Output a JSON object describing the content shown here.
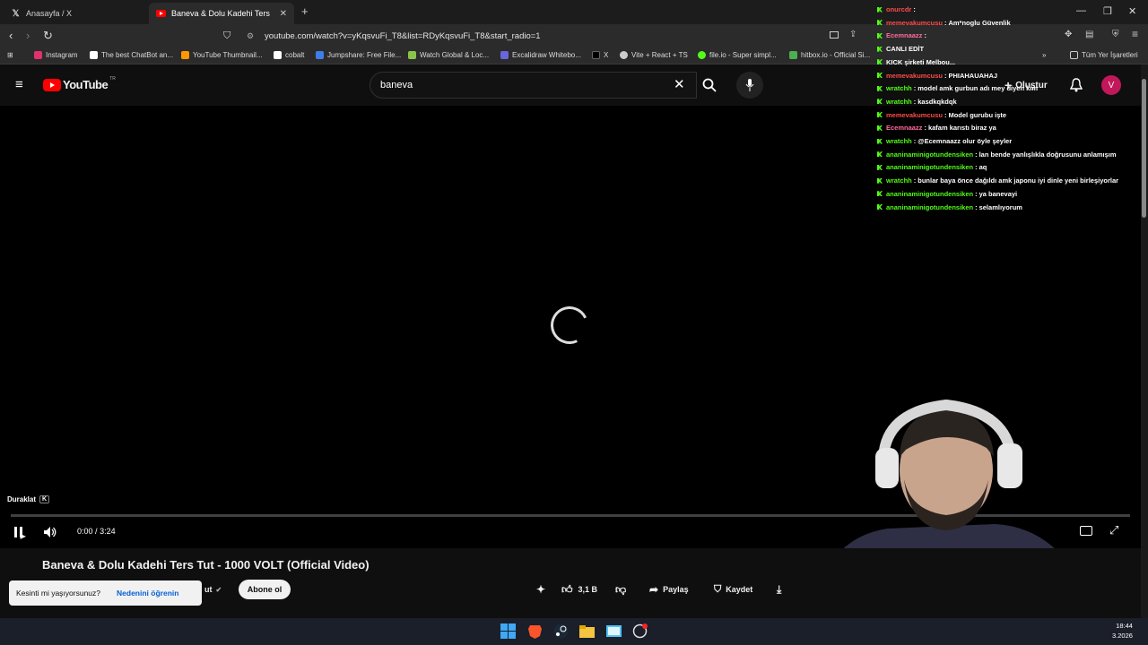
{
  "browser": {
    "tabs": [
      {
        "label": "Anasayfa / X",
        "active": false
      },
      {
        "label": "Baneva & Dolu Kadehi Ters Tut -",
        "active": true
      }
    ],
    "new_tab": "+",
    "url": "youtube.com/watch?v=yKqsvuFi_T8&list=RDyKqsvuFi_T8&start_radio=1",
    "bookmarks": [
      {
        "label": "Instagram",
        "color": "#e1306c"
      },
      {
        "label": "The best ChatBot an...",
        "color": "#ffffff"
      },
      {
        "label": "YouTube Thumbnail...",
        "color": "#ff9800"
      },
      {
        "label": "cobalt",
        "color": "#ffffff"
      },
      {
        "label": "Jumpshare: Free File...",
        "color": "#3f7de8"
      },
      {
        "label": "Watch Global & Loc...",
        "color": "#8bc34a"
      },
      {
        "label": "Excalidraw Whitebo...",
        "color": "#6965db"
      },
      {
        "label": "X",
        "color": "#000000"
      },
      {
        "label": "Vite + React + TS",
        "color": "#cccccc"
      },
      {
        "label": "file.io - Super simpl...",
        "color": "#53fc18"
      },
      {
        "label": "hitbox.io - Official Si...",
        "color": "#4caf50"
      }
    ],
    "all_bookmarks": "Tüm Yer İşaretleri",
    "overflow": "»"
  },
  "youtube": {
    "logo": "YouTube",
    "logo_region": "TR",
    "search_value": "baneva",
    "create_label": "Oluştur",
    "avatar_letter": "V",
    "accent": "#ff0000"
  },
  "player": {
    "tooltip": "Duraklat",
    "tooltip_key": "K",
    "time_current": "0:00",
    "time_separator": "/",
    "time_total": "3:24",
    "progress": 0.0
  },
  "video": {
    "title": "Baneva & Dolu Kadehi Ters Tut - 1000 VOLT (Official Video)",
    "channel_fragment": "ut",
    "subscribe_label": "Abone ol",
    "likes": "3,1 B",
    "share_label": "Paylaş",
    "save_label": "Kaydet"
  },
  "toast": {
    "text": "Kesinti mi yaşıyorsunuz?",
    "link": "Nedenini öğrenin"
  },
  "chat": [
    {
      "user": "onurcdr",
      "color": "#ff4b4b",
      "message": ""
    },
    {
      "user": "memevakumcusu",
      "color": "#ff4b4b",
      "message": "Am*noglu Güvenlik"
    },
    {
      "user": "Ecemnaazz",
      "color": "#ff6b9d",
      "message": ""
    },
    {
      "user": "",
      "color": "#ff4b4b",
      "message": "CANLI EDİT"
    },
    {
      "user": "",
      "color": "#ff4b4b",
      "message": "KICK şirketi Melbou..."
    },
    {
      "user": "memevakumcusu",
      "color": "#ff4b4b",
      "message": "PHIAHAUAHAJ"
    },
    {
      "user": "wratchh",
      "color": "#53fc18",
      "message": "model amk gurbun adı mey diyen kim"
    },
    {
      "user": "wratchh",
      "color": "#53fc18",
      "message": "kasdkqkdqk"
    },
    {
      "user": "memevakumcusu",
      "color": "#ff4b4b",
      "message": "Model gurubu işte"
    },
    {
      "user": "Ecemnaazz",
      "color": "#ff6b9d",
      "message": "kafam karıstı biraz ya"
    },
    {
      "user": "wratchh",
      "color": "#53fc18",
      "message": "@Ecemnaazz olur öyle şeyler"
    },
    {
      "user": "ananinaminigotundensiken",
      "color": "#53fc18",
      "message": "lan bende yanlışlıkla doğrusunu anlamışım"
    },
    {
      "user": "ananinaminigotundensiken",
      "color": "#53fc18",
      "message": "aq"
    },
    {
      "user": "wratchh",
      "color": "#53fc18",
      "message": "bunlar baya önce dağıldı amk japonu iyi dinle yeni birleşiyorlar"
    },
    {
      "user": "ananinaminigotundensiken",
      "color": "#53fc18",
      "message": "ya banevayi"
    },
    {
      "user": "ananinaminigotundensiken",
      "color": "#53fc18",
      "message": "selamlıyorum"
    }
  ],
  "taskbar": {
    "time": "18:44",
    "date": "3.2026"
  }
}
